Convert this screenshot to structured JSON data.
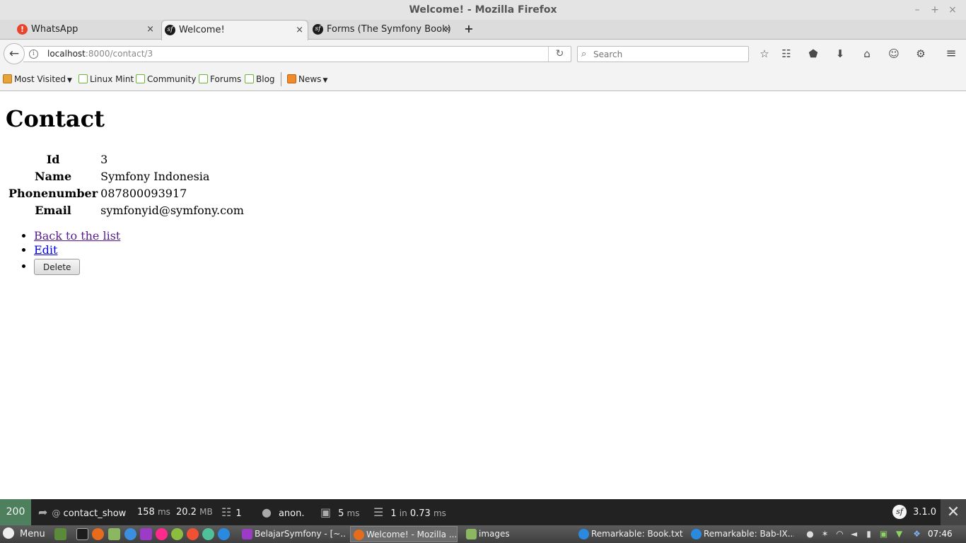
{
  "window": {
    "title": "Welcome! - Mozilla Firefox",
    "controls": {
      "minimize": "–",
      "maximize": "+",
      "close": "×"
    }
  },
  "tabs": [
    {
      "label": "WhatsApp",
      "icon": "whatsapp-alert-icon"
    },
    {
      "label": "Welcome!",
      "icon": "symfony-icon",
      "selected": true
    },
    {
      "label": "Forms (The Symfony Book)",
      "icon": "symfony-icon"
    }
  ],
  "tab_close_glyph": "×",
  "new_tab_glyph": "+",
  "navigation": {
    "url_host": "localhost",
    "url_rest": ":8000/contact/3",
    "search_placeholder": "Search"
  },
  "toolbar_icons": [
    "bookmark-star-icon",
    "reading-list-icon",
    "pocket-icon",
    "download-icon",
    "home-icon",
    "hello-icon",
    "extension-icon",
    "hamburger-menu-icon"
  ],
  "bookmarks": [
    {
      "label": "Most Visited",
      "icon": "folder-icon",
      "dropdown": true
    },
    {
      "label": "Linux Mint",
      "icon": "mint-icon"
    },
    {
      "label": "Community",
      "icon": "mint-icon"
    },
    {
      "label": "Forums",
      "icon": "mint-icon"
    },
    {
      "label": "Blog",
      "icon": "mint-icon"
    },
    {
      "label": "News",
      "icon": "rss-icon",
      "dropdown": true
    }
  ],
  "page": {
    "title": "Contact",
    "fields": [
      {
        "label": "Id",
        "value": "3"
      },
      {
        "label": "Name",
        "value": "Symfony Indonesia"
      },
      {
        "label": "Phonenumber",
        "value": "087800093917"
      },
      {
        "label": "Email",
        "value": "symfonyid@symfony.com"
      }
    ],
    "actions": {
      "back_label": "Back to the list",
      "edit_label": "Edit",
      "delete_label": "Delete"
    }
  },
  "symfony_toolbar": {
    "status_code": "200",
    "route": "contact_show",
    "route_prefix": "@",
    "time_value": "158",
    "time_unit": "ms",
    "memory_value": "20.2",
    "memory_unit": "MB",
    "forms_count": "1",
    "user": "anon.",
    "twig_value": "5",
    "twig_unit": "ms",
    "db_queries": "1",
    "db_in": "in",
    "db_time": "0.73",
    "db_unit": "ms",
    "version": "3.1.0",
    "status_color": "#4f805d"
  },
  "taskbar": {
    "menu_label": "Menu",
    "launchers": [
      "show-desktop-icon",
      "terminal-icon",
      "firefox-icon",
      "files-icon",
      "chrome-icon",
      "phpstorm-icon",
      "flickr-icon",
      "android-icon",
      "git-icon",
      "app-icon",
      "remarkable-icon"
    ],
    "tasks": [
      {
        "label": "BelajarSymfony - [~...",
        "icon": "phpstorm-icon"
      },
      {
        "label": "Welcome! - Mozilla ...",
        "icon": "firefox-icon",
        "active": true
      },
      {
        "label": "images",
        "icon": "folder-icon"
      },
      {
        "label": "Remarkable: Book.txt",
        "icon": "remarkable-icon"
      },
      {
        "label": "Remarkable: Bab-IX...",
        "icon": "remarkable-icon"
      }
    ],
    "tray_icons": [
      "user-icon",
      "bluetooth-icon",
      "wifi-icon",
      "volume-icon",
      "battery-icon",
      "update-icon",
      "shield-icon",
      "dropbox-icon"
    ],
    "clock": "07:46"
  }
}
